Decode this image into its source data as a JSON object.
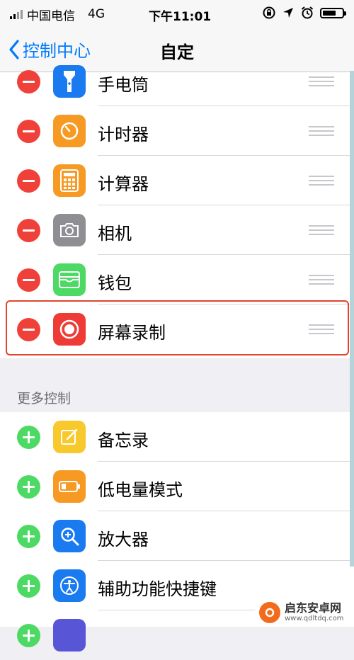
{
  "status_bar": {
    "carrier": "中国电信",
    "network": "4G",
    "time": "下午11:01"
  },
  "nav": {
    "back_label": "控制中心",
    "title": "自定"
  },
  "included": [
    {
      "label": "手电筒",
      "icon": "flashlight-icon",
      "color": "#1a7bf0"
    },
    {
      "label": "计时器",
      "icon": "timer-icon",
      "color": "#f79a24"
    },
    {
      "label": "计算器",
      "icon": "calculator-icon",
      "color": "#f79a24"
    },
    {
      "label": "相机",
      "icon": "camera-icon",
      "color": "#8e8e93"
    },
    {
      "label": "钱包",
      "icon": "wallet-icon",
      "color": "#4cd964"
    },
    {
      "label": "屏幕录制",
      "icon": "screen-record-icon",
      "color": "#ee3b35"
    }
  ],
  "more_controls": {
    "header": "更多控制",
    "items": [
      {
        "label": "备忘录",
        "icon": "notes-icon",
        "color": "#f8c92d"
      },
      {
        "label": "低电量模式",
        "icon": "low-power-icon",
        "color": "#f79a24"
      },
      {
        "label": "放大器",
        "icon": "magnifier-icon",
        "color": "#1a7bf0"
      },
      {
        "label": "辅助功能快捷键",
        "icon": "accessibility-icon",
        "color": "#1a7bf0"
      }
    ]
  },
  "watermark": {
    "name": "启东安卓网",
    "url": "www.qdltdq.com"
  },
  "colors": {
    "accent": "#007aff",
    "remove": "#f0403a",
    "add": "#4cd964",
    "highlight": "#e0452e"
  }
}
